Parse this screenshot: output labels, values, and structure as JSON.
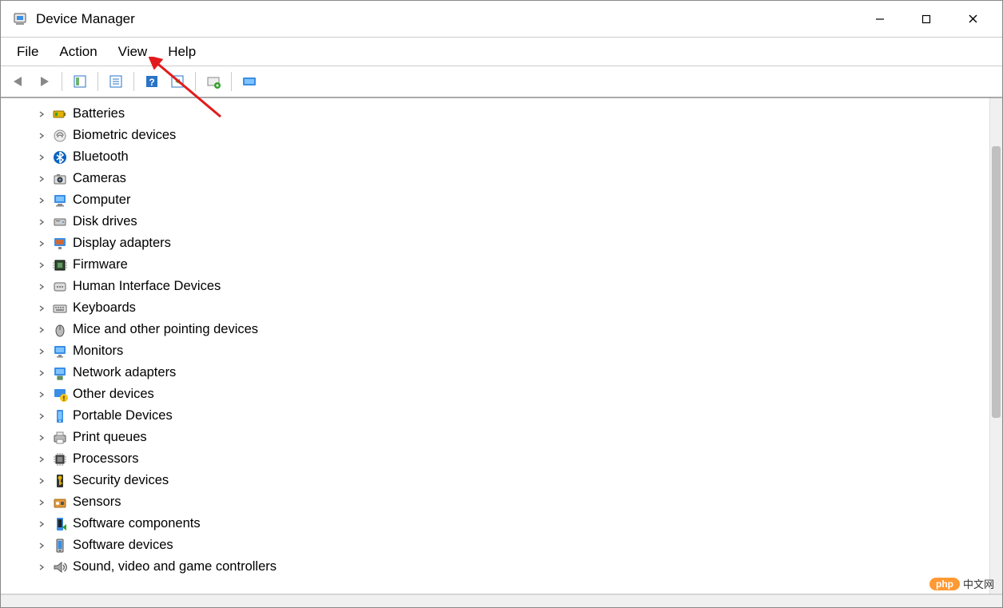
{
  "title": "Device Manager",
  "menu": {
    "file": "File",
    "action": "Action",
    "view": "View",
    "help": "Help"
  },
  "toolbar_icons": [
    "back-icon",
    "forward-icon",
    "show-hide-tree-icon",
    "properties-icon",
    "help-icon",
    "update-driver-icon",
    "scan-hardware-icon",
    "add-legacy-icon"
  ],
  "categories": [
    {
      "label": "Batteries",
      "icon": "battery-icon"
    },
    {
      "label": "Biometric devices",
      "icon": "fingerprint-icon"
    },
    {
      "label": "Bluetooth",
      "icon": "bluetooth-icon"
    },
    {
      "label": "Cameras",
      "icon": "camera-icon"
    },
    {
      "label": "Computer",
      "icon": "computer-icon"
    },
    {
      "label": "Disk drives",
      "icon": "disk-icon"
    },
    {
      "label": "Display adapters",
      "icon": "display-adapter-icon"
    },
    {
      "label": "Firmware",
      "icon": "firmware-icon"
    },
    {
      "label": "Human Interface Devices",
      "icon": "hid-icon"
    },
    {
      "label": "Keyboards",
      "icon": "keyboard-icon"
    },
    {
      "label": "Mice and other pointing devices",
      "icon": "mouse-icon"
    },
    {
      "label": "Monitors",
      "icon": "monitor-icon"
    },
    {
      "label": "Network adapters",
      "icon": "network-icon"
    },
    {
      "label": "Other devices",
      "icon": "other-devices-icon"
    },
    {
      "label": "Portable Devices",
      "icon": "portable-device-icon"
    },
    {
      "label": "Print queues",
      "icon": "printer-icon"
    },
    {
      "label": "Processors",
      "icon": "processor-icon"
    },
    {
      "label": "Security devices",
      "icon": "security-icon"
    },
    {
      "label": "Sensors",
      "icon": "sensor-icon"
    },
    {
      "label": "Software components",
      "icon": "software-component-icon"
    },
    {
      "label": "Software devices",
      "icon": "software-device-icon"
    },
    {
      "label": "Sound, video and game controllers",
      "icon": "sound-icon"
    }
  ],
  "watermark": {
    "badge": "php",
    "text": "中文网"
  }
}
